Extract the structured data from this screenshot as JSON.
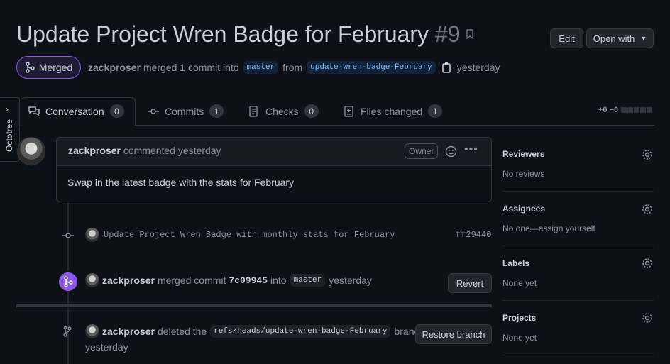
{
  "pr": {
    "title": "Update Project Wren Badge for February",
    "number": "#9",
    "edit_label": "Edit",
    "open_with_label": "Open with",
    "state_label": "Merged",
    "author": "zackproser",
    "merge_text": "merged 1 commit into",
    "base_branch": "master",
    "from_text": "from",
    "head_branch": "update-wren-badge-February",
    "time": "yesterday"
  },
  "octotree": {
    "label": "Octotree"
  },
  "tabs": [
    {
      "label": "Conversation",
      "count": "0"
    },
    {
      "label": "Commits",
      "count": "1"
    },
    {
      "label": "Checks",
      "count": "0"
    },
    {
      "label": "Files changed",
      "count": "1"
    }
  ],
  "diffstat": "+0 −0",
  "comment": {
    "author": "zackproser",
    "action": "commented yesterday",
    "role": "Owner",
    "body": "Swap in the latest badge with the stats for February"
  },
  "timeline": {
    "commit_message": "Update Project Wren Badge with monthly stats for February",
    "commit_sha": "ff29440",
    "merge_author": "zackproser",
    "merge_text1": "merged commit",
    "merge_sha": "7c09945",
    "merge_text2": "into",
    "merge_branch": "master",
    "merge_time": "yesterday",
    "revert_label": "Revert",
    "delete_author": "zackproser",
    "delete_text": "deleted the",
    "delete_ref": "refs/heads/update-wren-badge-February",
    "delete_suffix": "branch",
    "delete_time": "yesterday",
    "restore_label": "Restore branch"
  },
  "sidebar": {
    "reviewers": {
      "title": "Reviewers",
      "value": "No reviews"
    },
    "assignees": {
      "title": "Assignees",
      "value": "No one—assign yourself"
    },
    "labels": {
      "title": "Labels",
      "value": "None yet"
    },
    "projects": {
      "title": "Projects",
      "value": "None yet"
    }
  },
  "colors": {
    "background": "#0d1117",
    "merged_purple": "#8957e5",
    "link_blue": "#79c0ff",
    "muted": "#8b949e"
  }
}
